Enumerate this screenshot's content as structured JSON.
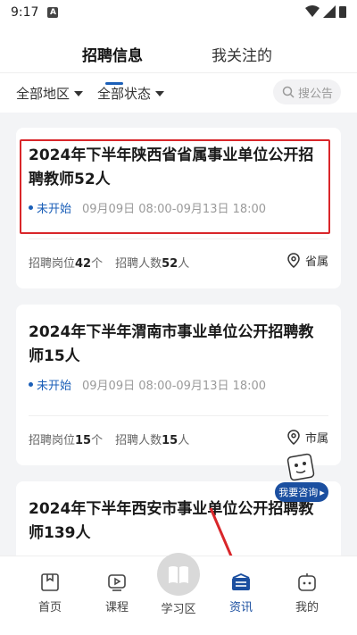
{
  "status_bar": {
    "time": "9:17",
    "app_badge": "A"
  },
  "tabs": [
    {
      "label": "招聘信息",
      "active": true
    },
    {
      "label": "我关注的",
      "active": false
    }
  ],
  "filters": {
    "region": "全部地区",
    "status": "全部状态"
  },
  "search": {
    "placeholder": "搜公告"
  },
  "cards": [
    {
      "title": "2024年下半年陕西省省属事业单位公开招聘教师52人",
      "status": "未开始",
      "date": "09月09日 08:00-09月13日 18:00",
      "positions_label": "招聘岗位",
      "positions": "42",
      "positions_unit": "个",
      "people_label": "招聘人数",
      "people": "52",
      "people_unit": "人",
      "location": "省属"
    },
    {
      "title": "2024年下半年渭南市事业单位公开招聘教师15人",
      "status": "未开始",
      "date": "09月09日 08:00-09月13日 18:00",
      "positions_label": "招聘岗位",
      "positions": "15",
      "positions_unit": "个",
      "people_label": "招聘人数",
      "people": "15",
      "people_unit": "人",
      "location": "市属"
    },
    {
      "title": "2024年下半年西安市事业单位公开招聘教师139人"
    }
  ],
  "consult": {
    "label": "我要咨询"
  },
  "bottom_nav": [
    {
      "label": "首页",
      "icon": "home-icon"
    },
    {
      "label": "课程",
      "icon": "course-icon"
    },
    {
      "label": "学习区",
      "icon": "study-icon"
    },
    {
      "label": "资讯",
      "icon": "news-icon",
      "active": true
    },
    {
      "label": "我的",
      "icon": "profile-icon"
    }
  ],
  "colors": {
    "accent": "#1b5fb8",
    "highlight": "#d9262a",
    "nav_active": "#1b4fa0"
  }
}
